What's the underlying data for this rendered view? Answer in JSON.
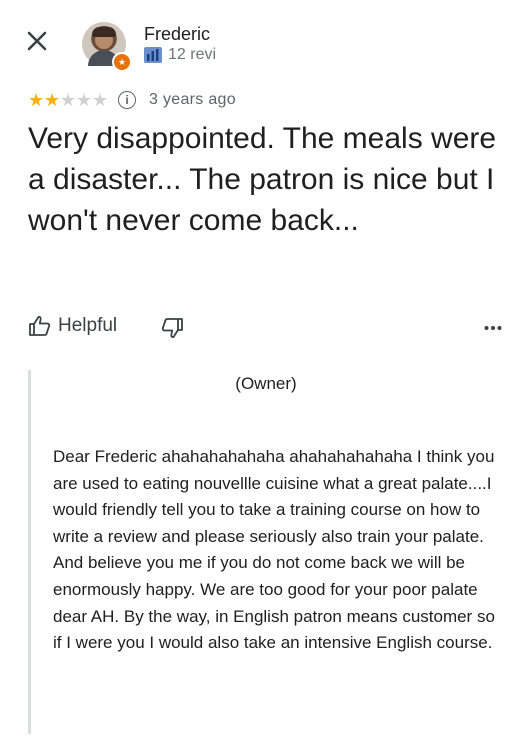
{
  "header": {
    "close_icon": "close-icon",
    "author_name": "Frederic",
    "author_meta": "12 revi",
    "badge_icon": "local-guide-star-icon",
    "meta_icon": "local-guide-icon"
  },
  "review": {
    "rating": 2,
    "rating_max": 5,
    "time_ago": "3 years ago",
    "text": "Very disappointed. The meals were a disaster... The patron is nice but I won't never come back..."
  },
  "actions": {
    "helpful_label": "Helpful",
    "helpful_icon": "thumbs-up-icon",
    "unhelpful_icon": "thumbs-down-icon",
    "more_icon": "more-horizontal-icon"
  },
  "owner_reply": {
    "label": "(Owner)",
    "text": "Dear Frederic ahahahahahaha ahahahahahaha I think you are used to eating nouvellle cuisine what a great palate....I would friendly tell you to take a training course  on how to write a review and please seriously also train your palate. And believe you me if you do not come back we will be enormously happy.  We are too good for your poor palate   dear AH.  By the way, in English patron means customer so if I were you I would also take an intensive English course."
  },
  "colors": {
    "star_filled": "#f6b300",
    "star_empty": "#d0d0d0",
    "badge": "#e8710a",
    "secondary_text": "#70757a"
  }
}
